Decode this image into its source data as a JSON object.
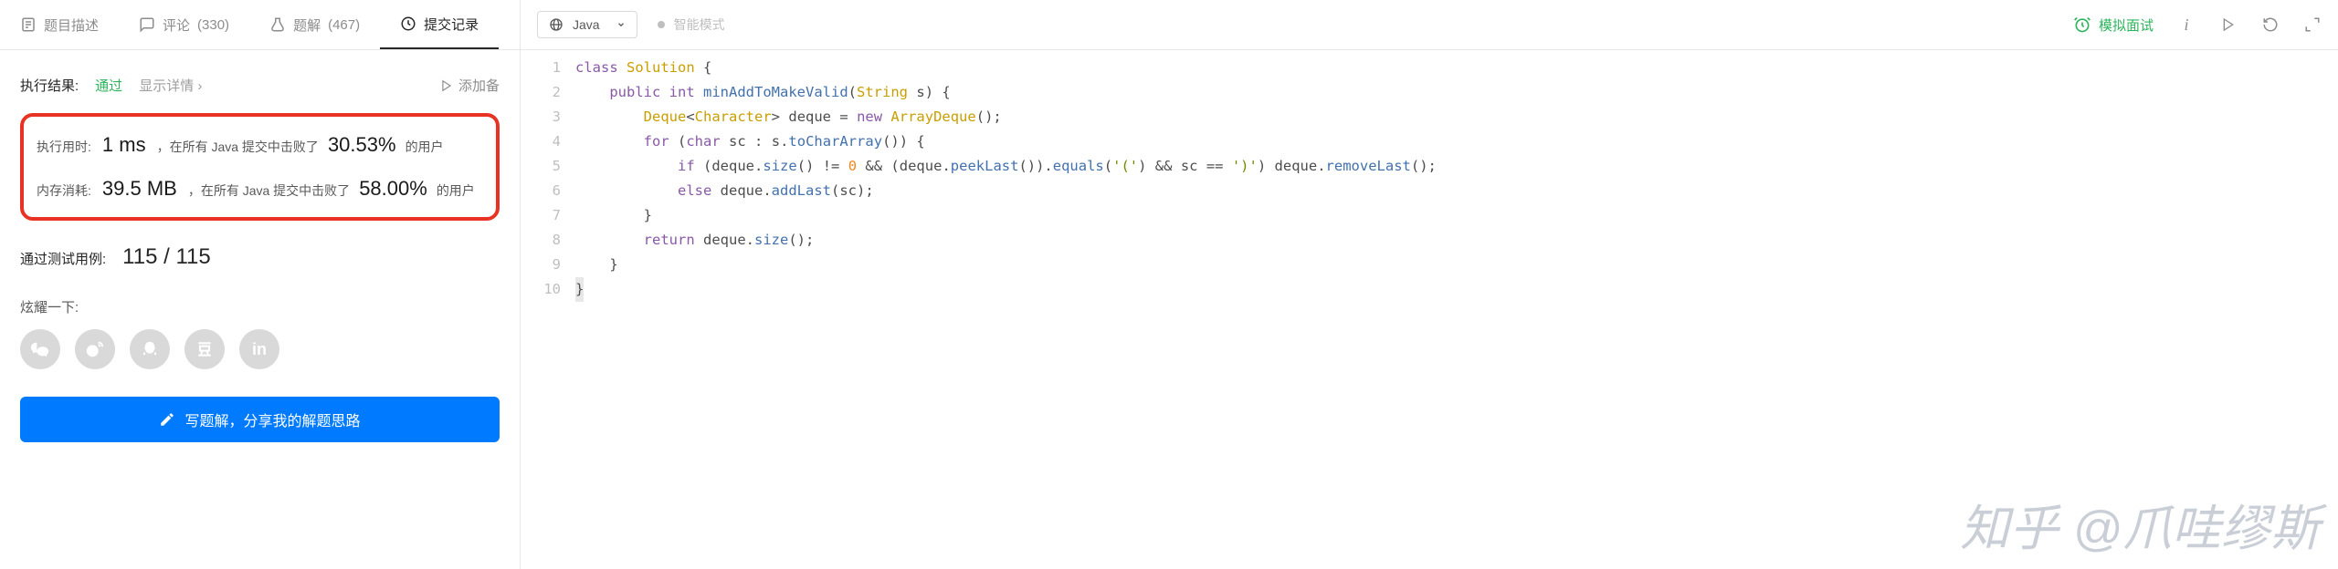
{
  "tabs": {
    "description": "题目描述",
    "comments_label": "评论",
    "comments_count": "(330)",
    "solutions_label": "题解",
    "solutions_count": "(467)",
    "submissions": "提交记录"
  },
  "result": {
    "label": "执行结果:",
    "status": "通过",
    "show_details": "显示详情 ›",
    "add_note": "添加备",
    "runtime_label": "执行用时:",
    "runtime_value": "1 ms",
    "runtime_mid": "，在所有 Java 提交中击败了",
    "runtime_percent": "30.53%",
    "runtime_suffix": "的用户",
    "memory_label": "内存消耗:",
    "memory_value": "39.5 MB",
    "memory_mid": "，在所有 Java 提交中击败了",
    "memory_percent": "58.00%",
    "memory_suffix": "的用户",
    "testcases_label": "通过测试用例:",
    "testcases_value": "115 / 115",
    "share_label": "炫耀一下:",
    "write_button": "写题解，分享我的解题思路"
  },
  "editor": {
    "language": "Java",
    "smart_mode": "智能模式",
    "mock_interview": "模拟面试",
    "info_btn": "i"
  },
  "code_lines": [
    "1",
    "2",
    "3",
    "4",
    "5",
    "6",
    "7",
    "8",
    "9",
    "10"
  ],
  "watermark": "知乎 @爪哇缪斯"
}
